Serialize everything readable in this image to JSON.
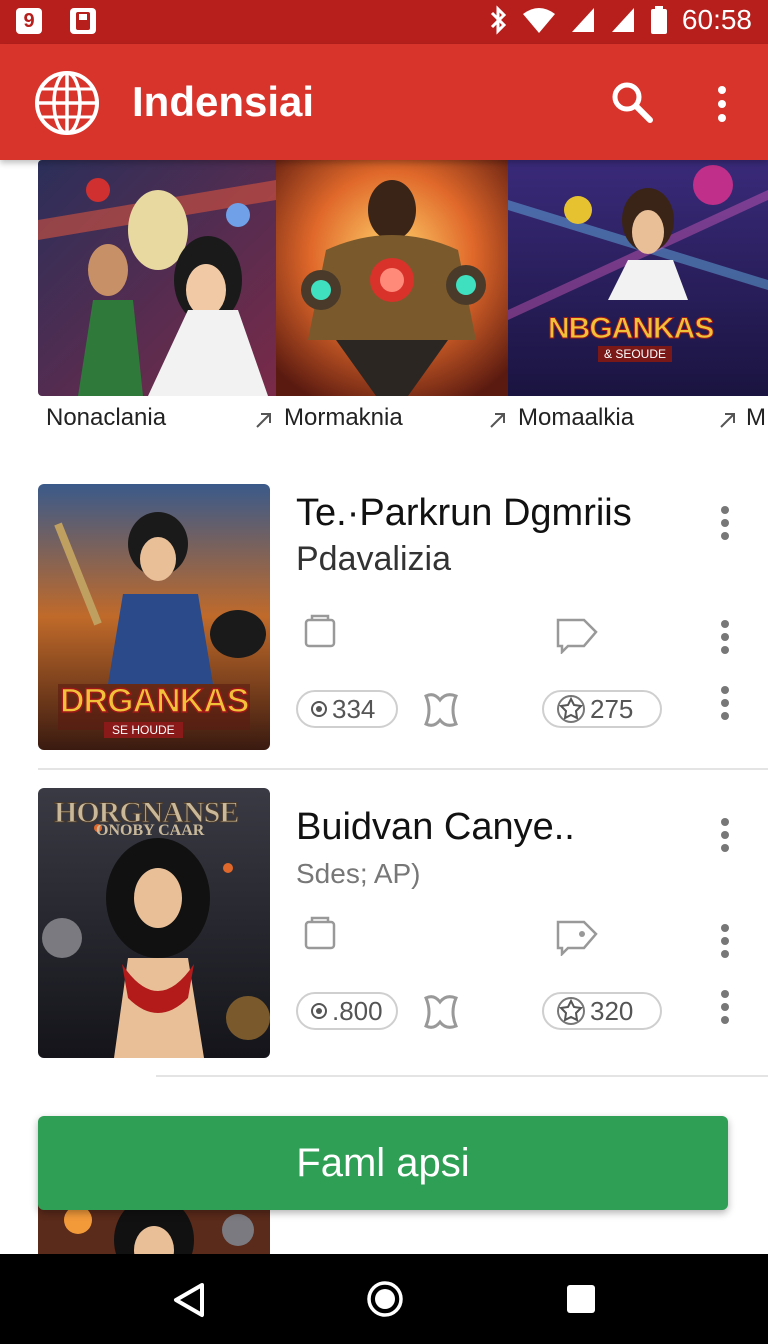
{
  "status_bar": {
    "time": "60:58",
    "left_icons": [
      "9",
      "sd-card-icon"
    ]
  },
  "app_bar": {
    "title": "Indensiai"
  },
  "carousel": {
    "items": [
      {
        "label": "Nonaclania"
      },
      {
        "label": "Mormaknia"
      },
      {
        "label": "Momaalkia"
      },
      {
        "label": "M"
      }
    ],
    "banner_text": "NBGANKAS",
    "banner_sub": "& SEOUDE"
  },
  "list": [
    {
      "title": "Te.·Parkrun Dgmriis",
      "subtitle": "Pdavalizia",
      "cover_title": "DRGANKAS",
      "cover_sub": "SE HOUDE",
      "stat_a": "334",
      "stat_b": "275"
    },
    {
      "title": "Buidvan Canye..",
      "subtitle": "Sdes; AP)",
      "cover_title": "HORGNANSE",
      "cover_sub": "ONOBY CAAR",
      "stat_a": ".800",
      "stat_b": "320"
    }
  ],
  "fab": {
    "label": "Faml apsi"
  }
}
